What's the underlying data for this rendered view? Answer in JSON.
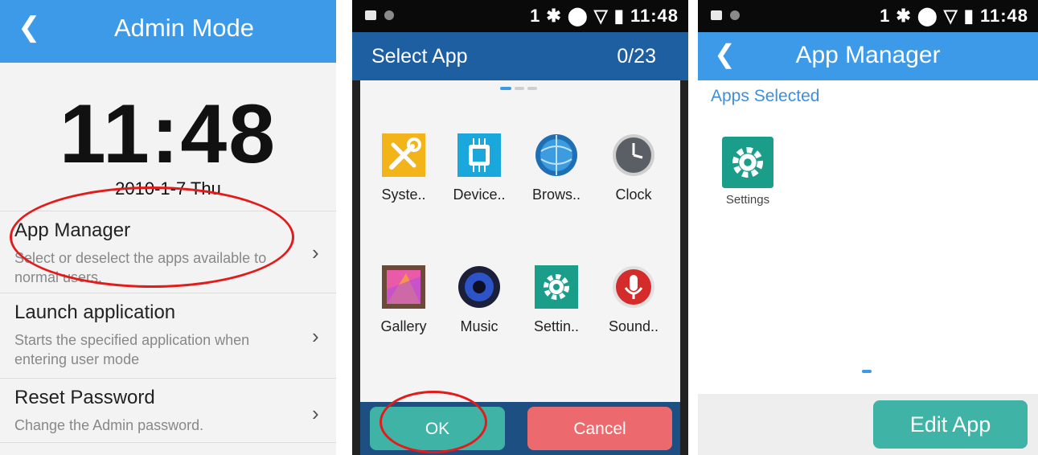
{
  "admin_mode": {
    "title": "Admin Mode",
    "time": "11:48",
    "date": "2010-1-7 Thu",
    "items": [
      {
        "title": "App Manager",
        "desc": "Select or deselect the apps available to normal users."
      },
      {
        "title": "Launch application",
        "desc": "Starts the specified application when entering user mode"
      },
      {
        "title": "Reset Password",
        "desc": "Change the Admin password."
      }
    ]
  },
  "status_bar": {
    "text": "1 ✱ ⬤ ▽ ▮ 11:48"
  },
  "select_app": {
    "title": "Select App",
    "count": "0/23",
    "apps": [
      {
        "label": "Syste..",
        "icon": "tools-icon"
      },
      {
        "label": "Device..",
        "icon": "chip-icon"
      },
      {
        "label": "Brows..",
        "icon": "globe-icon"
      },
      {
        "label": "Clock",
        "icon": "clock-icon"
      },
      {
        "label": "Gallery",
        "icon": "gallery-icon"
      },
      {
        "label": "Music",
        "icon": "speaker-icon"
      },
      {
        "label": "Settin..",
        "icon": "gear-icon"
      },
      {
        "label": "Sound..",
        "icon": "microphone-icon"
      }
    ],
    "ok_label": "OK",
    "cancel_label": "Cancel"
  },
  "app_manager": {
    "title": "App Manager",
    "section": "Apps Selected",
    "apps": [
      {
        "label": "Settings",
        "icon": "gear-icon"
      }
    ],
    "edit_label": "Edit App"
  },
  "colors": {
    "header_blue": "#3c9ae8",
    "dark_blue": "#1d5fa0",
    "teal": "#3eb3a6",
    "cancel_red": "#ec6a6e",
    "highlight": "#e31b1b"
  }
}
